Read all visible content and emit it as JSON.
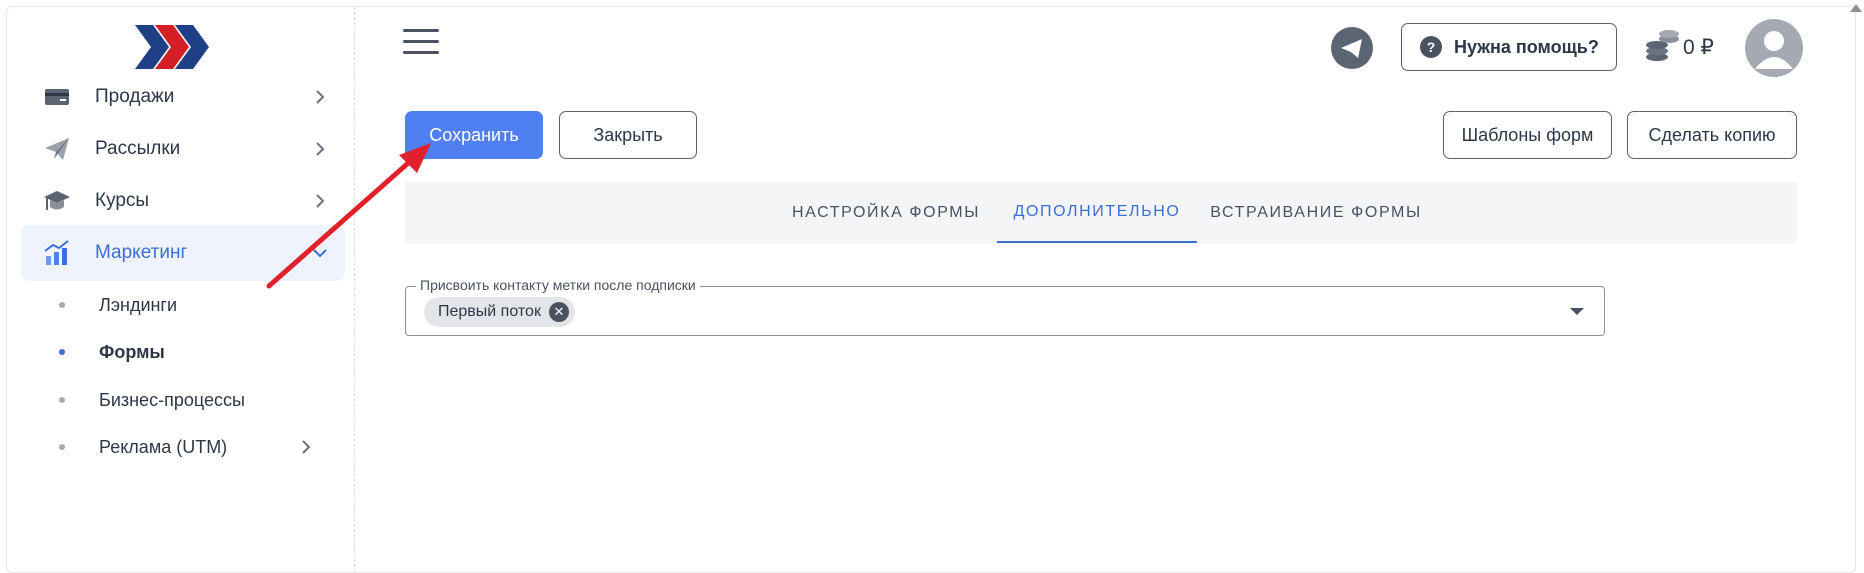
{
  "sidebar": {
    "items": [
      {
        "label": "Продажи",
        "icon": "credit-card-icon"
      },
      {
        "label": "Рассылки",
        "icon": "paper-plane-icon"
      },
      {
        "label": "Курсы",
        "icon": "graduation-cap-icon"
      },
      {
        "label": "Маркетинг",
        "icon": "chart-up-icon"
      }
    ],
    "subitems": [
      {
        "label": "Лэндинги"
      },
      {
        "label": "Формы"
      },
      {
        "label": "Бизнес-процессы"
      },
      {
        "label": "Реклама (UTM)"
      }
    ]
  },
  "header": {
    "help_label": "Нужна помощь?",
    "help_icon": "?",
    "balance": "0 ₽"
  },
  "actions": {
    "save_label": "Сохранить",
    "close_label": "Закрыть",
    "templates_label": "Шаблоны форм",
    "copy_label": "Сделать копию"
  },
  "tabs": [
    {
      "label": "НАСТРОЙКА ФОРМЫ"
    },
    {
      "label": "ДОПОЛНИТЕЛЬНО"
    },
    {
      "label": "ВСТРАИВАНИЕ ФОРМЫ"
    }
  ],
  "form": {
    "tags_label": "Присвоить контакту метки после подписки",
    "chip_label": "Первый поток",
    "chip_remove": "✕"
  },
  "colors": {
    "accent": "#4f7ff0",
    "active_text": "#3b6fd6",
    "active_bg": "#eef3fd",
    "arrow": "#e0202a"
  }
}
